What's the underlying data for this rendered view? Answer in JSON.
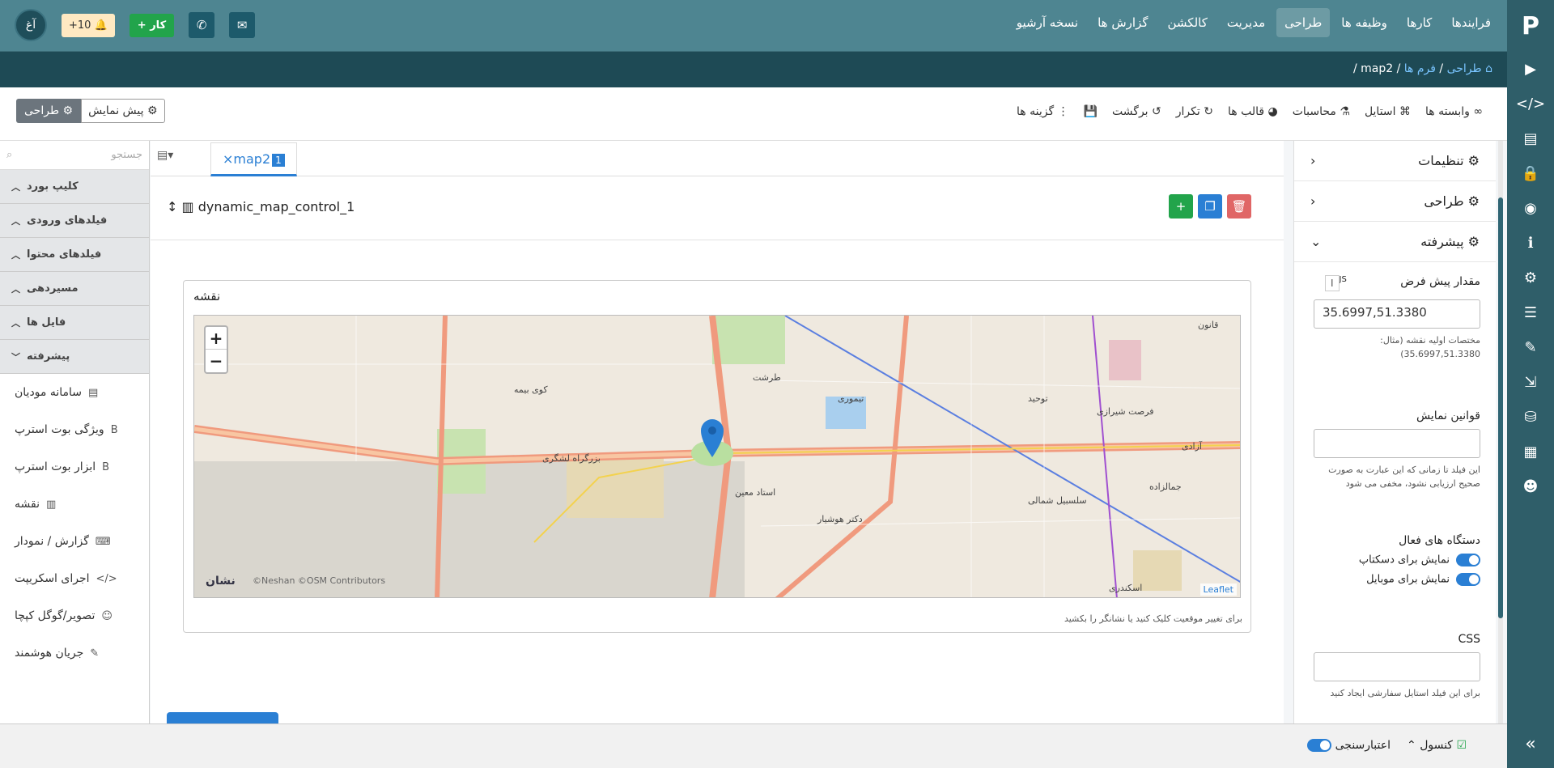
{
  "topbar": {
    "nav": [
      "فرایندها",
      "کارها",
      "وظیفه ها",
      "طراحی",
      "مدیریت",
      "کالکشن",
      "گزارش ها",
      "نسخه آرشیو"
    ],
    "active_nav": "طراحی",
    "avatar": "آغ",
    "notifications": "+10",
    "work_button": "کار",
    "icons": [
      "bell-icon",
      "plus-icon",
      "phone-icon",
      "envelope-icon"
    ]
  },
  "breadcrumb": {
    "home": "طراحی",
    "forms": "فرم ها",
    "current": "map2"
  },
  "toolbar": {
    "items": [
      "وابسته ها",
      "استایل",
      "محاسبات",
      "قالب ها",
      "تکرار",
      "برگشت",
      "",
      "گزینه ها"
    ],
    "preview": "پیش نمایش",
    "design": "طراحی"
  },
  "left": {
    "search_placeholder": "جستجو",
    "sections": [
      "کلیپ بورد",
      "فیلدهای ورودی",
      "فیلدهای محتوا",
      "مسیردهی",
      "فایل ها",
      "پیشرفته"
    ],
    "items": [
      "سامانه مودیان",
      "ویژگی بوت استرپ",
      "ابزار بوت استرپ",
      "نقشه",
      "گزارش / نمودار",
      "اجرای اسکریپت",
      "تصویر/گوگل کپچا",
      "جریان هوشمند"
    ]
  },
  "canvas": {
    "tab_label": "map2",
    "tab_number": "1",
    "control_name": "dynamic_map_control_1",
    "map_title": "نقشه",
    "map_hint": "برای تغییر موقعیت کلیک کنید یا نشانگر را بکشید",
    "attribution": "Leaflet",
    "credits": "©Neshan ©OSM Contributors",
    "neshan": "نشان",
    "zoom_in": "+",
    "zoom_out": "−",
    "map_labels": [
      "بزرگراه لشگری",
      "استاد معین",
      "تیموری",
      "توحید",
      "فرصت شیرازی",
      "جمالزاده",
      "دکتر هوشیار",
      "سلسبیل شمالی",
      "کوی بیمه",
      "طرشت",
      "آزادی",
      "اسکندری",
      "قانون"
    ]
  },
  "right": {
    "sections": [
      "تنظیمات",
      "طراحی",
      "پیشرفته"
    ],
    "default_label": "مقدار پیش فرض",
    "default_value": "35.6997,51.3380",
    "default_help": "مختصات اولیه نقشه (مثال: 35.6997,51.3380)",
    "display_rules_label": "قوانین نمایش",
    "display_rules_help": "این فیلد تا زمانی که این عبارت به صورت صحیح ارزیابی نشود، مخفی می شود",
    "devices_label": "دستگاه های فعال",
    "desktop": "نمایش برای دسکتاپ",
    "mobile": "نمایش برای موبایل",
    "css_label": "CSS",
    "css_help": "برای این فیلد استایل سفارشی ایجاد کنید"
  },
  "bottom": {
    "console": "کنسول",
    "validation": "اعتبارسنجی"
  },
  "colors": {
    "brand": "#4e8591",
    "accent": "#2a7fd4",
    "add": "#22a44b",
    "delete": "#e06666"
  }
}
